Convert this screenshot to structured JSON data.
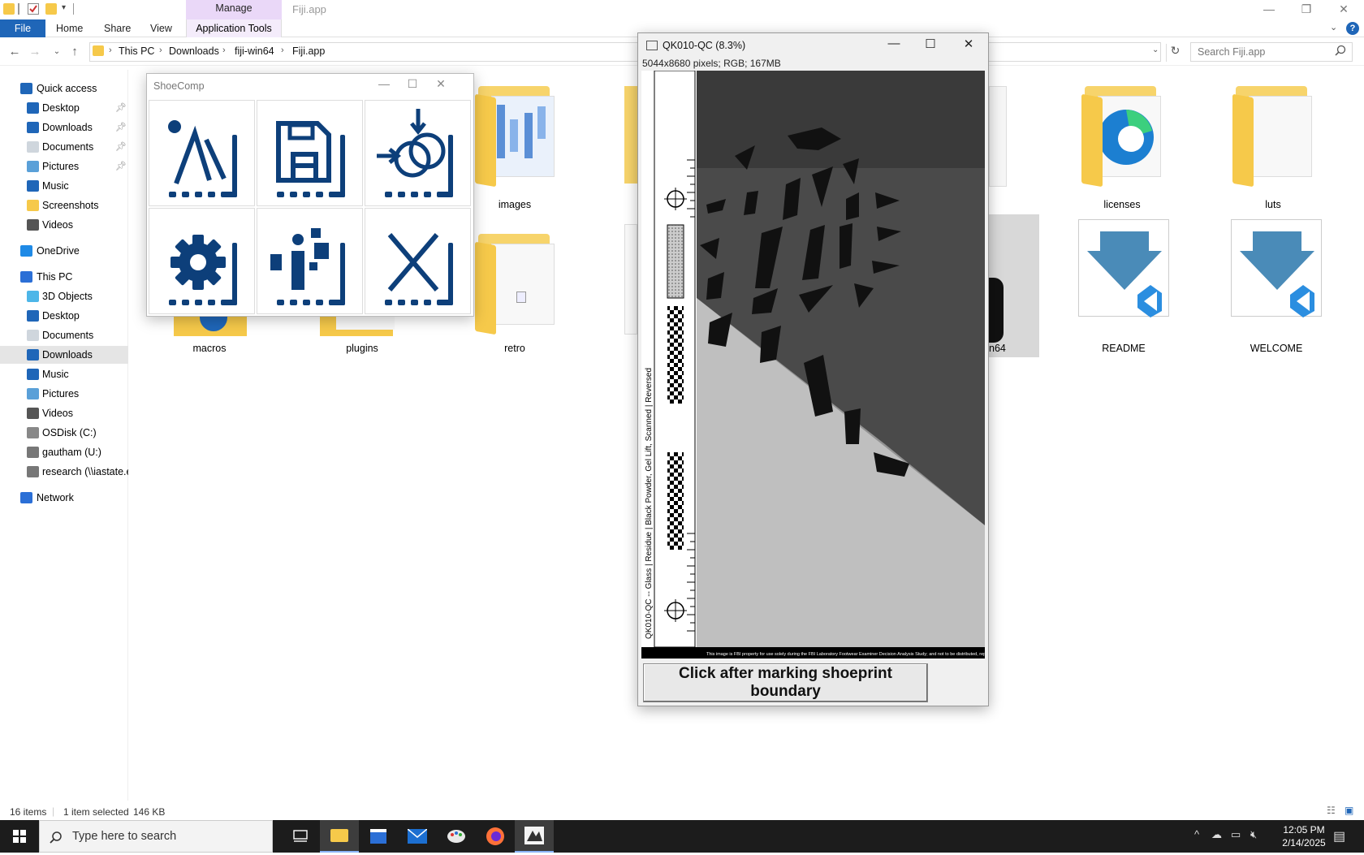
{
  "explorer": {
    "title": "Fiji.app",
    "manage_label": "Manage",
    "ribbon": {
      "file": "File",
      "home": "Home",
      "share": "Share",
      "view": "View",
      "app_tools": "Application Tools"
    },
    "breadcrumb": [
      "This PC",
      "Downloads",
      "fiji-win64",
      "Fiji.app"
    ],
    "search_placeholder": "Search Fiji.app",
    "sidebar": [
      {
        "label": "Quick access",
        "icon": "star-icon",
        "level": 0
      },
      {
        "label": "Desktop",
        "icon": "desktop-icon",
        "level": 1,
        "pinned": true
      },
      {
        "label": "Downloads",
        "icon": "download-icon",
        "level": 1,
        "pinned": true
      },
      {
        "label": "Documents",
        "icon": "documents-icon",
        "level": 1,
        "pinned": true
      },
      {
        "label": "Pictures",
        "icon": "pictures-icon",
        "level": 1,
        "pinned": true
      },
      {
        "label": "Music",
        "icon": "music-icon",
        "level": 1
      },
      {
        "label": "Screenshots",
        "icon": "folder-icon",
        "level": 1
      },
      {
        "label": "Videos",
        "icon": "videos-icon",
        "level": 1
      },
      {
        "label": "OneDrive",
        "icon": "cloud-icon",
        "level": 0
      },
      {
        "label": "This PC",
        "icon": "pc-icon",
        "level": 0
      },
      {
        "label": "3D Objects",
        "icon": "cube-icon",
        "level": 1
      },
      {
        "label": "Desktop",
        "icon": "desktop-icon",
        "level": 1
      },
      {
        "label": "Documents",
        "icon": "documents-icon",
        "level": 1
      },
      {
        "label": "Downloads",
        "icon": "download-icon",
        "level": 1,
        "selected": true
      },
      {
        "label": "Music",
        "icon": "music-icon",
        "level": 1
      },
      {
        "label": "Pictures",
        "icon": "pictures-icon",
        "level": 1
      },
      {
        "label": "Videos",
        "icon": "videos-icon",
        "level": 1
      },
      {
        "label": "OSDisk (C:)",
        "icon": "drive-icon",
        "level": 1
      },
      {
        "label": "gautham (U:)",
        "icon": "network-drive-icon",
        "level": 1
      },
      {
        "label": "research (\\\\iastate.e",
        "icon": "network-drive-icon",
        "level": 1
      },
      {
        "label": "Network",
        "icon": "network-icon",
        "level": 0
      }
    ],
    "items": {
      "images": "images",
      "licenses": "licenses",
      "luts": "luts",
      "macros": "macros",
      "plugins": "plugins",
      "retro": "retro",
      "win64_partial": "n64",
      "readme": "README",
      "welcome": "WELCOME"
    },
    "status": {
      "count": "16 items",
      "selection": "1 item selected",
      "size": "146 KB"
    }
  },
  "shoecomp": {
    "title": "ShoeComp"
  },
  "image_window": {
    "title": "QK010-QC (8.3%)",
    "info": "5044x8680 pixels; RGB; 167MB",
    "button": "Click after marking shoeprint boundary",
    "scale_caption": "QK010-QC -- Glass | Residue | Black Powder, Gel Lift, Scanned | Reversed"
  },
  "taskbar": {
    "search_placeholder": "Type here to search",
    "time": "12:05 PM",
    "date": "2/14/2025"
  },
  "colors": {
    "accent": "#1f66b8",
    "shoecomp_icon": "#0d3f7a",
    "folder": "#f6c94a",
    "manage_tab": "#ead8f8",
    "taskbar": "#1c1c1c"
  }
}
